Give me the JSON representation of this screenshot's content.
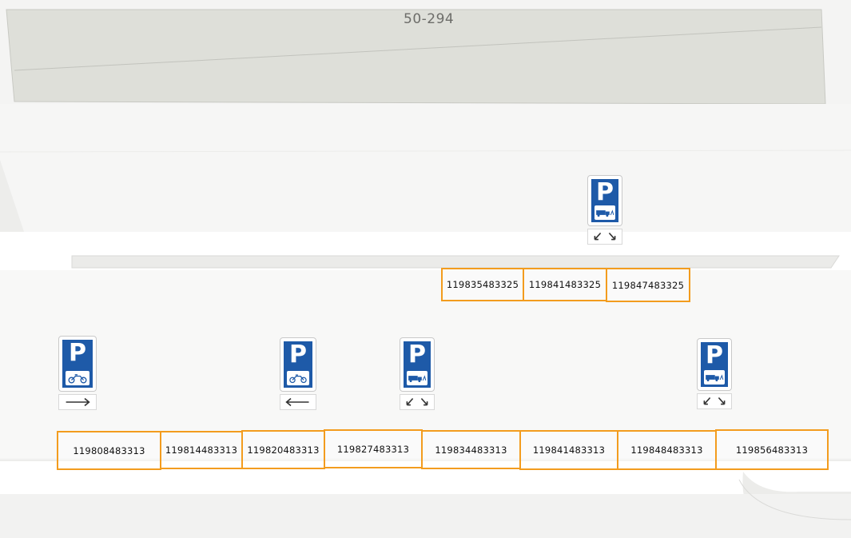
{
  "map": {
    "building_label": "50-294",
    "colors": {
      "building_fill": "#dedfd9",
      "road": "#ffffff",
      "background": "#f4f4f3",
      "bay_border": "#f39c1e",
      "sign_blue": "#1e5aa8"
    },
    "parking_signs": [
      {
        "symbol": "P",
        "vehicle": "truck-icon",
        "direction": "diagonal-arrows-icon"
      },
      {
        "symbol": "P",
        "vehicle": "moped-icon",
        "direction": "arrow-right-icon"
      },
      {
        "symbol": "P",
        "vehicle": "moped-icon",
        "direction": "arrow-left-icon"
      },
      {
        "symbol": "P",
        "vehicle": "truck-icon",
        "direction": "diagonal-arrows-icon"
      },
      {
        "symbol": "P",
        "vehicle": "truck-icon",
        "direction": "diagonal-arrows-icon"
      }
    ],
    "upper_bays": [
      "119835483325",
      "119841483325",
      "119847483325"
    ],
    "lower_bays": [
      "119808483313",
      "119814483313",
      "119820483313",
      "119827483313",
      "119834483313",
      "119841483313",
      "119848483313",
      "119856483313"
    ]
  }
}
